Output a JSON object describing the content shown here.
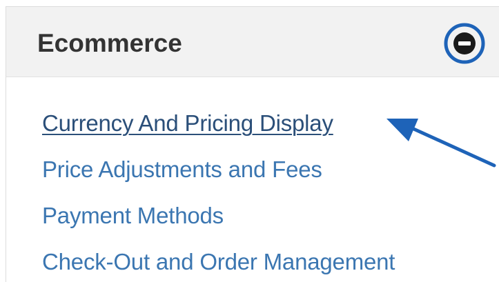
{
  "panel": {
    "title": "Ecommerce",
    "toggle_icon": "minus-circle-icon",
    "links": [
      {
        "label": "Currency And Pricing Display",
        "active": true
      },
      {
        "label": "Price Adjustments and Fees",
        "active": false
      },
      {
        "label": "Payment Methods",
        "active": false
      },
      {
        "label": "Check-Out and Order Management",
        "active": false
      }
    ]
  },
  "colors": {
    "link": "#3b76b1",
    "link_active": "#2b4f79",
    "header_bg": "#f2f2f2",
    "title_text": "#333333",
    "annotation": "#1e63b8"
  }
}
